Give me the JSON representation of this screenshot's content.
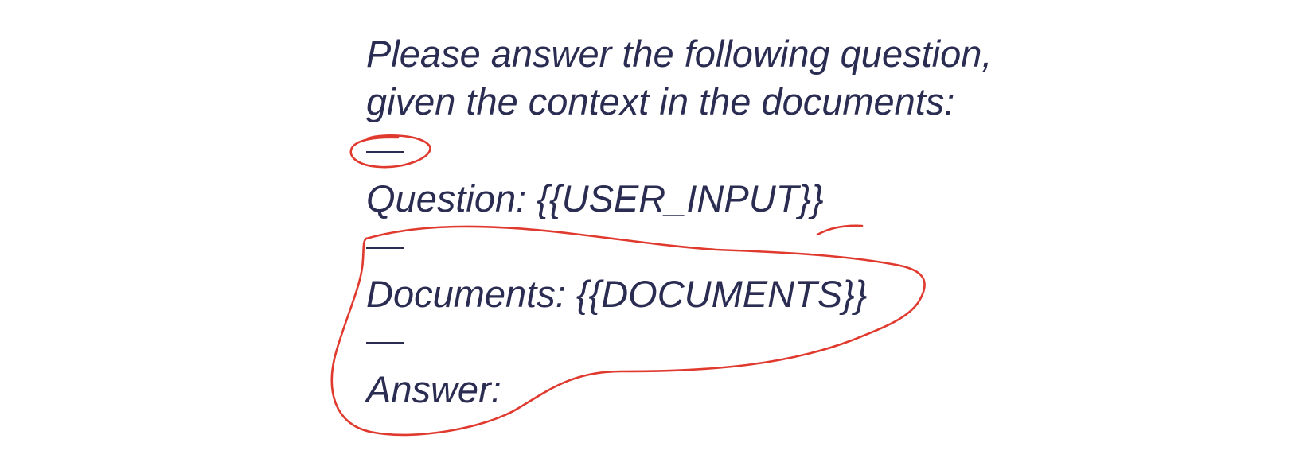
{
  "prompt": {
    "line1": "Please answer the following question,",
    "line2": "given the context in the documents:",
    "separator": "—",
    "question": "Question: {{USER_INPUT}}",
    "documents": "Documents: {{DOCUMENTS}}",
    "answer": "Answer:"
  },
  "colors": {
    "text": "#2a2c52",
    "annotation": "#e03a2f",
    "background": "#ffffff"
  }
}
